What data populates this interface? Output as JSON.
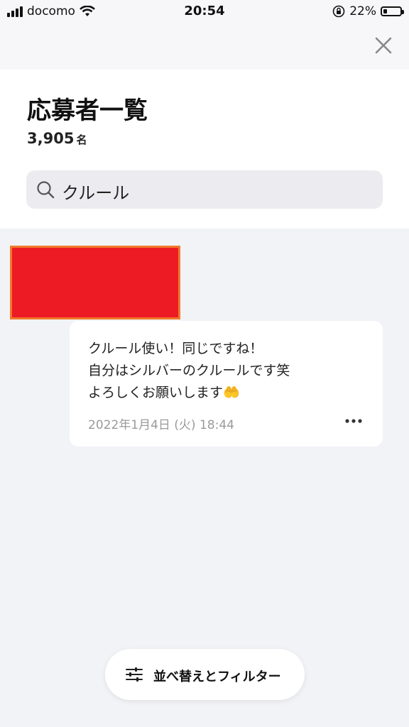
{
  "status_bar": {
    "carrier": "docomo",
    "time": "20:54",
    "battery_percent": "22%",
    "battery_level": 0.22
  },
  "header": {
    "title": "応募者一覧",
    "count": "3,905",
    "count_unit": "名"
  },
  "search": {
    "query": "クルール"
  },
  "applicants": [
    {
      "message": "クルール使い！同じですね！\n自分はシルバーのクルールです笑\nよろしくお願いします🤲",
      "date": "2022年1月4日 (火) 18:44"
    }
  ],
  "footer": {
    "sort_filter_label": "並べ替えとフィルター"
  },
  "colors": {
    "background": "#f2f3f7",
    "card": "#ffffff",
    "redaction_fill": "#ed1b24",
    "redaction_border": "#f07a2d",
    "secondary_text": "#9a9a9a"
  },
  "icons": [
    "signal-icon",
    "wifi-icon",
    "rotation-lock-icon",
    "battery-icon",
    "close-icon",
    "search-icon",
    "more-icon",
    "filter-icon"
  ]
}
